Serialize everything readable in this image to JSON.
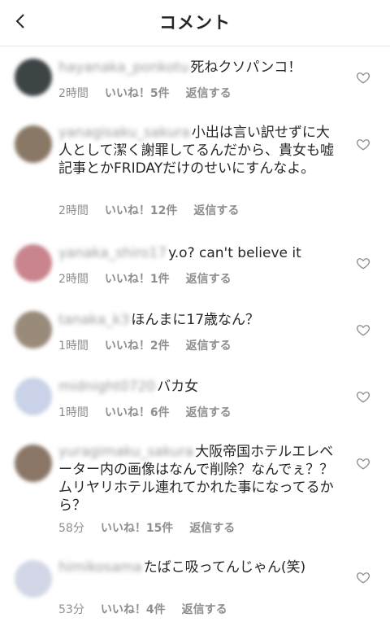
{
  "header": {
    "title": "コメント"
  },
  "comments": [
    {
      "username": "hayanaka_ponkotu",
      "text": "死ねクソパンコ！",
      "time": "2時間",
      "likes": "いいね！5件",
      "reply": "返信する",
      "avatar_color": "#3d4446"
    },
    {
      "username": "yanagisaku_sakura",
      "text": "小出は言い訳せずに大人として潔く謝罪してるんだから、貴女も嘘記事とかFRIDAYだけのせいにすんなよ。",
      "time": "2時間",
      "likes": "いいね！12件",
      "reply": "返信する",
      "avatar_color": "#8a7866"
    },
    {
      "username": "yanaka_shiro17",
      "text": "y.o? can't believe it",
      "time": "2時間",
      "likes": "いいね！1件",
      "reply": "返信する",
      "avatar_color": "#c9848d"
    },
    {
      "username": "tanaka_k3",
      "text": "ほんまに17歳なん？",
      "time": "1時間",
      "likes": "いいね！2件",
      "reply": "返信する",
      "avatar_color": "#9a8a7a"
    },
    {
      "username": "midnight0720",
      "text": "バカ女",
      "time": "1時間",
      "likes": "いいね！6件",
      "reply": "返信する",
      "avatar_color": "#c9d2e8"
    },
    {
      "username": "yuragimaku_sakura",
      "text": "大阪帝国ホテルエレベーター内の画像はなんで削除？なんでぇ？？ムリヤリホテル連れてかれた事になってるから？",
      "time": "58分",
      "likes": "いいね！15件",
      "reply": "返信する",
      "avatar_color": "#8a7666"
    },
    {
      "username": "himikosama",
      "text": "たばこ吸ってんじゃん(笑)",
      "time": "53分",
      "likes": "いいね！4件",
      "reply": "返信する",
      "avatar_color": "#d3d6e6"
    }
  ]
}
